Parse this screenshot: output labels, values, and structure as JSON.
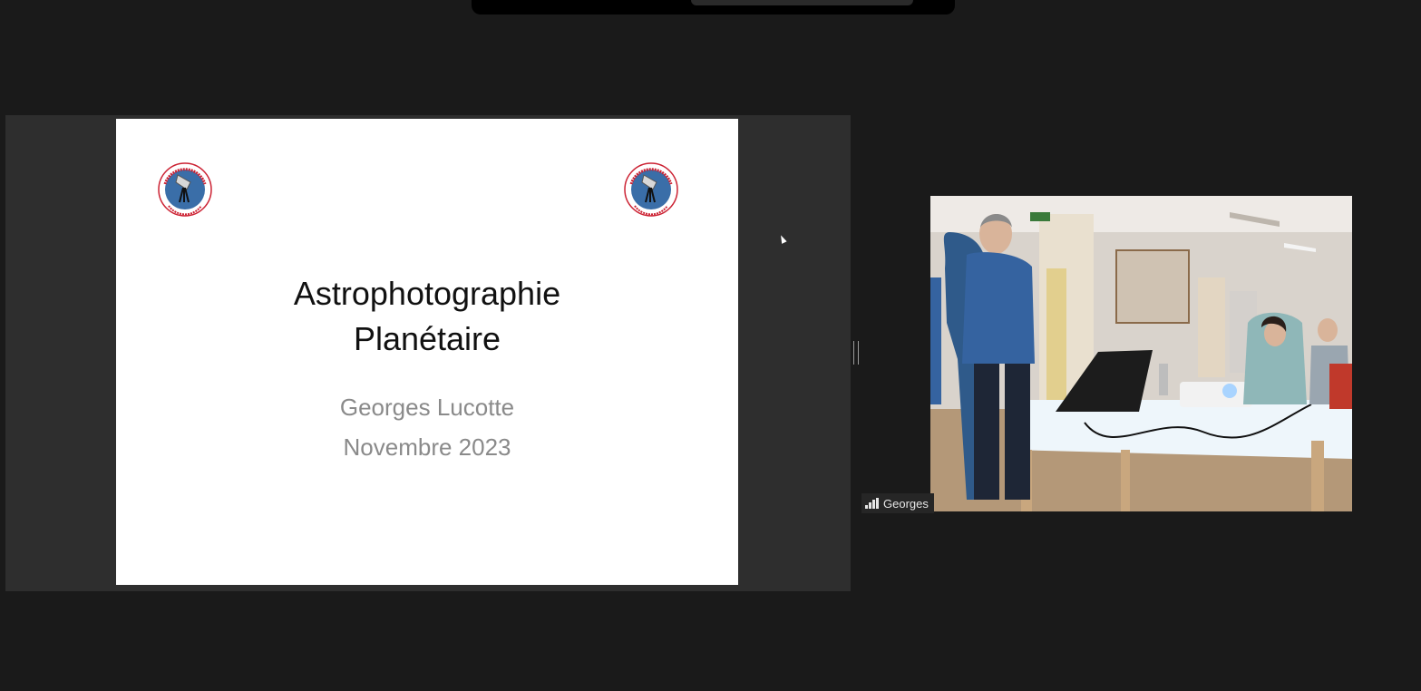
{
  "slide": {
    "title_line1": "Astrophotographie",
    "title_line2": "Planétaire",
    "author": "Georges Lucotte",
    "date": "Novembre 2023"
  },
  "participant": {
    "name": "Georges",
    "signal_bars": 4
  },
  "colors": {
    "background": "#1a1a1a",
    "share_panel": "#2e2e2e",
    "slide_background": "#ffffff",
    "title": "#111111",
    "subtitle": "#8a8a8a",
    "logo_ring": "#cc2233",
    "logo_globe": "#3a6ea8"
  },
  "icons": {
    "club_logo": "club-astronomie-logo",
    "signal": "signal-strength-icon",
    "cursor": "mouse-pointer-icon"
  }
}
